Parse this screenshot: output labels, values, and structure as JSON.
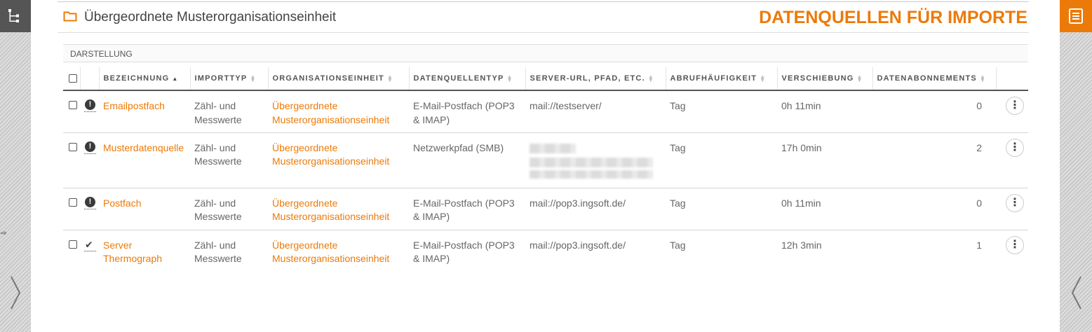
{
  "header": {
    "title": "Übergeordnete Musterorganisationseinheit",
    "section_title": "DATENQUELLEN FÜR IMPORTE"
  },
  "toolbar": {
    "darstellung_label": "DARSTELLUNG"
  },
  "colors": {
    "accent": "#ec7a08",
    "rail": "#555555"
  },
  "table": {
    "columns": [
      "BEZEICHNUNG",
      "IMPORTTYP",
      "ORGANISATIONSEINHEIT",
      "DATENQUELLENTYP",
      "SERVER-URL, PFAD, ETC.",
      "ABRUFHÄUFIGKEIT",
      "VERSCHIEBUNG",
      "DATENABONNEMENTS"
    ],
    "sorted_column": "BEZEICHNUNG",
    "sort_direction": "ascending",
    "rows": [
      {
        "status": "warning",
        "status_icon": "exclamation-circle-icon",
        "name": "Emailpostfach",
        "importtyp_1": "Zähl- und",
        "importtyp_2": "Messwerte",
        "org_1": "Übergeordnete",
        "org_2": "Musterorganisationseinheit",
        "typ_1": "E-Mail-Postfach (POP3",
        "typ_2": "& IMAP)",
        "url": "mail://testserver/",
        "haeufigkeit": "Tag",
        "verschiebung": "0h 11min",
        "abos": "0"
      },
      {
        "status": "warning",
        "status_icon": "exclamation-circle-icon",
        "name": "Musterdatenquelle",
        "importtyp_1": "Zähl- und",
        "importtyp_2": "Messwerte",
        "org_1": "Übergeordnete",
        "org_2": "Musterorganisationseinheit",
        "typ_1": "Netzwerkpfad (SMB)",
        "typ_2": "",
        "url": "",
        "haeufigkeit": "Tag",
        "verschiebung": "17h 0min",
        "abos": "2"
      },
      {
        "status": "warning",
        "status_icon": "exclamation-circle-icon",
        "name": "Postfach",
        "importtyp_1": "Zähl- und",
        "importtyp_2": "Messwerte",
        "org_1": "Übergeordnete",
        "org_2": "Musterorganisationseinheit",
        "typ_1": "E-Mail-Postfach (POP3",
        "typ_2": "& IMAP)",
        "url": "mail://pop3.ingsoft.de/",
        "haeufigkeit": "Tag",
        "verschiebung": "0h 11min",
        "abos": "0"
      },
      {
        "status": "ok",
        "status_icon": "checkmark-icon",
        "name_1": "Server",
        "name_2": "Thermograph",
        "importtyp_1": "Zähl- und",
        "importtyp_2": "Messwerte",
        "org_1": "Übergeordnete",
        "org_2": "Musterorganisationseinheit",
        "typ_1": "E-Mail-Postfach (POP3",
        "typ_2": "& IMAP)",
        "url": "mail://pop3.ingsoft.de/",
        "haeufigkeit": "Tag",
        "verschiebung": "12h 3min",
        "abos": "1"
      }
    ]
  }
}
